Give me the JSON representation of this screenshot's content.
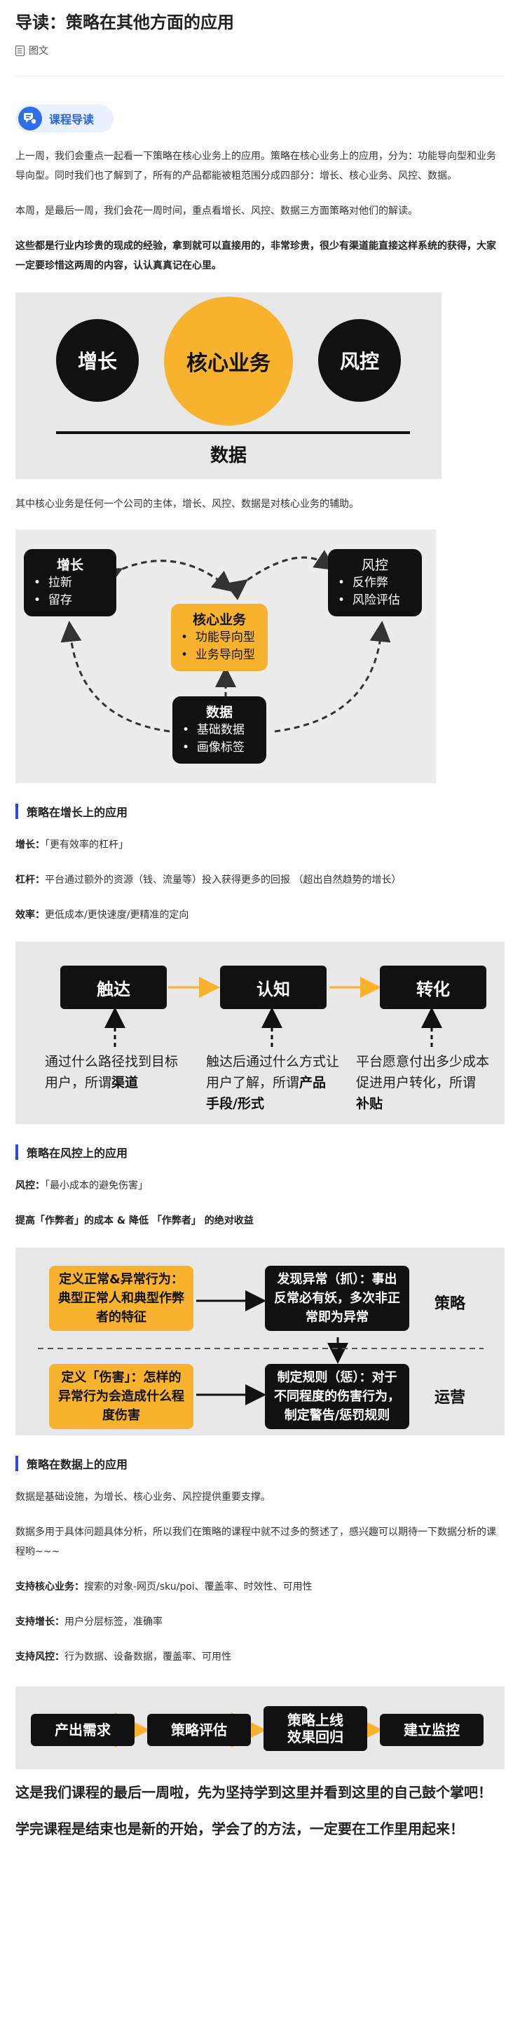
{
  "header": {
    "title": "导读：策略在其他方面的应用",
    "type_label": "图文"
  },
  "badge": {
    "label": "课程导读"
  },
  "intro": {
    "p1": "上一周，我们会重点一起看一下策略在核心业务上的应用。策略在核心业务上的应用，分为：功能导向型和业务导向型。同时我们也了解到了，所有的产品都能被粗范围分成四部分：增长、核心业务、风控、数据。",
    "p2": "本周，是最后一周，我们会花一周时间，重点看增长、风控、数据三方面策略对他们的解读。",
    "p3": "这些都是行业内珍贵的现成的经验，拿到就可以直接用的，非常珍贵，很少有渠道能直接这样系统的获得，大家一定要珍惜这两周的内容，认认真真记在心里。"
  },
  "fig1": {
    "growth": "增长",
    "core": "核心业务",
    "risk": "风控",
    "data": "数据"
  },
  "fig1_caption": "其中核心业务是任何一个公司的主体，增长、风控、数据是对核心业务的辅助。",
  "fig2": {
    "growth": {
      "title": "增长",
      "items": [
        "拉新",
        "留存"
      ]
    },
    "risk": {
      "title": "风控",
      "items": [
        "反作弊",
        "风险评估"
      ]
    },
    "core": {
      "title": "核心业务",
      "items": [
        "功能导向型",
        "业务导向型"
      ]
    },
    "data": {
      "title": "数据",
      "items": [
        "基础数据",
        "画像标签"
      ]
    },
    "bullet": "•"
  },
  "growth_section": {
    "title": "策略在增长上的应用",
    "line1_key": "增长：",
    "line1_val": "「更有效率的杠杆」",
    "line2_key": "杠杆：",
    "line2_val": "平台通过额外的资源（钱、流量等）投入获得更多的回报 （超出自然趋势的增长）",
    "line3_key": "效率：",
    "line3_val": "更低成本/更快速度/更精准的定向"
  },
  "fig3": {
    "steps": [
      "触达",
      "认知",
      "转化"
    ],
    "desc1_a": "通过什么路径找到目标用户，所谓",
    "desc1_b": "渠道",
    "desc2_a": "触达后通过什么方式让用户了解，所谓",
    "desc2_b": "产品手段/形式",
    "desc3_a": "平台愿意付出多少成本促进用户转化，所谓",
    "desc3_b": "补贴"
  },
  "risk_section": {
    "title": "策略在风控上的应用",
    "line1_key": "风控：",
    "line1_val": "「最小成本的避免伤害」",
    "line2": "提高「作弊者」的成本 & 降低 「作弊者」 的绝对收益"
  },
  "fig4": {
    "box1": "定义正常&异常行为：典型正常人和典型作弊者的特征",
    "box2": "发现异常（抓）：事出反常必有妖，多次非正常即为异常",
    "box3": "定义「伤害」：怎样的异常行为会造成什么程度伤害",
    "box4": "制定规则（惩）：对于不同程度的伤害行为，制定警告/惩罚规则",
    "label_strategy": "策略",
    "label_ops": "运营"
  },
  "data_section": {
    "title": "策略在数据上的应用",
    "p1": "数据是基础设施，为增长、核心业务、风控提供重要支撑。",
    "p2": "数据多用于具体问题具体分析，所以我们在策略的课程中就不过多的赘述了，感兴趣可以期待一下数据分析的课程哟~~~",
    "s1_key": "支持核心业务：",
    "s1_val": "搜索的对象-网页/sku/poi、覆盖率、时效性、可用性",
    "s2_key": "支持增长：",
    "s2_val": "用户分层标签，准确率",
    "s3_key": "支持风控：",
    "s3_val": "行为数据、设备数据，覆盖率、可用性"
  },
  "fig5": {
    "steps": [
      "产出需求",
      "策略评估",
      "策略上线\n效果回归",
      "建立监控"
    ]
  },
  "closing": {
    "p1": "这是我们课程的最后一周啦，先为坚持学到这里并看到这里的自己鼓个掌吧！",
    "p2": "学完课程是结束也是新的开始，学会了的方法，一定要在工作里用起来！"
  },
  "colors": {
    "accent_blue": "#2f4bd6",
    "gold": "#f7b22e",
    "black": "#111111",
    "badge_bg": "#e9f1fe"
  }
}
